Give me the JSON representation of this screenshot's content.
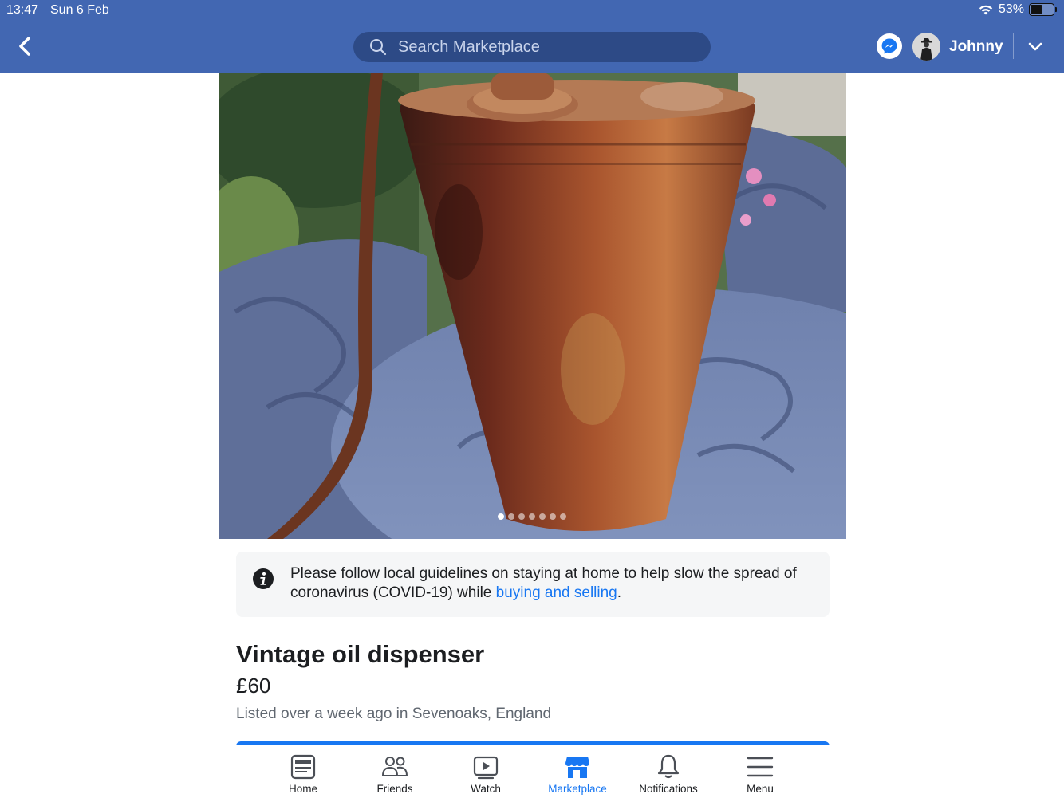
{
  "status_bar": {
    "time": "13:47",
    "date": "Sun 6 Feb",
    "battery": "53%",
    "battery_level": 0.53
  },
  "header": {
    "search_placeholder": "Search Marketplace",
    "user_name": "Johnny"
  },
  "photo": {
    "total_images": 7,
    "active_index": 0
  },
  "notice": {
    "text_before": "Please follow local guidelines on staying at home to help slow the spread of coronavirus (COVID-19) while ",
    "link_text": "buying and selling",
    "text_after": "."
  },
  "listing": {
    "title": "Vintage oil dispenser",
    "price": "£60",
    "listed": "Listed over a week ago in Sevenoaks, England"
  },
  "tabs": [
    {
      "label": "Home",
      "icon": "home-icon"
    },
    {
      "label": "Friends",
      "icon": "friends-icon"
    },
    {
      "label": "Watch",
      "icon": "watch-icon"
    },
    {
      "label": "Marketplace",
      "icon": "marketplace-icon"
    },
    {
      "label": "Notifications",
      "icon": "bell-icon"
    },
    {
      "label": "Menu",
      "icon": "menu-icon"
    }
  ],
  "colors": {
    "header_bg": "#4267b2",
    "accent": "#1877f2",
    "notice_bg": "#f5f6f7"
  }
}
